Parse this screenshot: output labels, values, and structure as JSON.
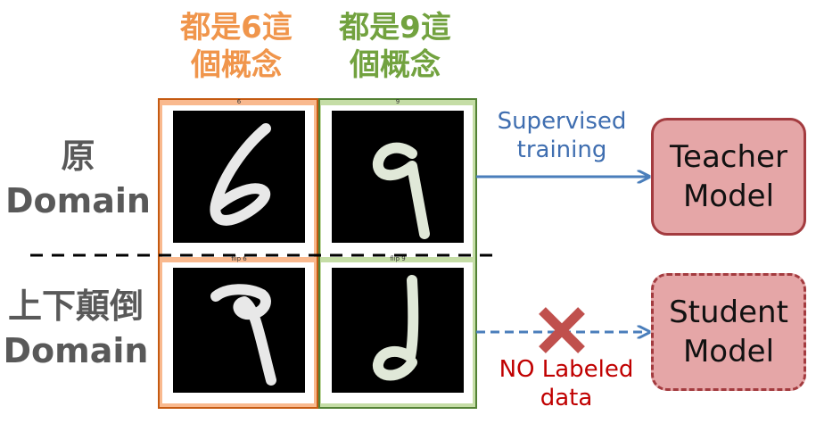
{
  "headers": {
    "left": [
      "都是6這",
      "個概念"
    ],
    "right": [
      "都是9這",
      "個概念"
    ]
  },
  "side_labels": {
    "top": [
      "原",
      "Domain"
    ],
    "bottom": [
      "上下顛倒",
      "Domain"
    ]
  },
  "plots": {
    "top_left_title": "6",
    "top_right_title": "9",
    "bottom_left_title": "flip 6",
    "bottom_right_title": "flip 9"
  },
  "models": {
    "teacher": [
      "Teacher",
      "Model"
    ],
    "student": [
      "Student",
      "Model"
    ]
  },
  "arrows": {
    "supervised": [
      "Supervised",
      "training"
    ],
    "no_label": [
      "NO Labeled",
      "data"
    ]
  },
  "colors": {
    "orange": "#F0954B",
    "green": "#72A23F",
    "arrow": "#4A7EBB",
    "model_fill": "#E5A6A7",
    "model_border": "#A33B3F",
    "cross": "#C0504D"
  }
}
